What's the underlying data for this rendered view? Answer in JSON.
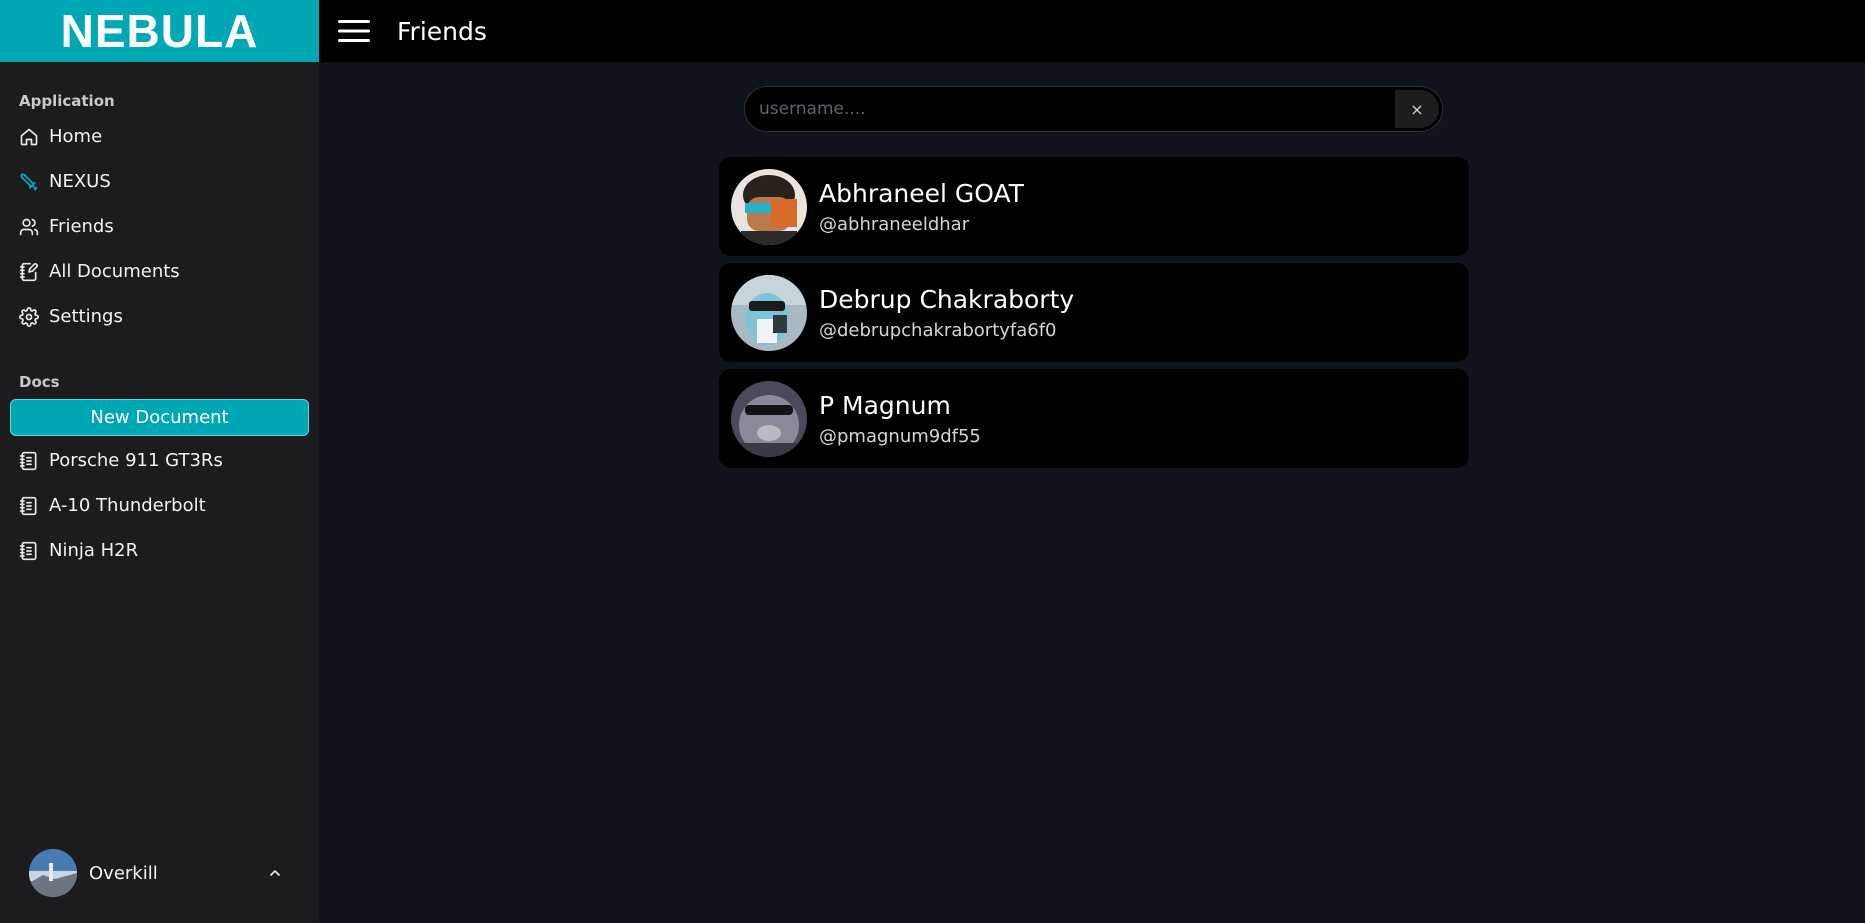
{
  "brand": {
    "title": "NEBULA"
  },
  "sidebar": {
    "application_label": "Application",
    "items": [
      {
        "label": "Home",
        "icon": "home-icon"
      },
      {
        "label": "NEXUS",
        "icon": "sword-icon"
      },
      {
        "label": "Friends",
        "icon": "users-icon"
      },
      {
        "label": "All Documents",
        "icon": "documents-icon"
      },
      {
        "label": "Settings",
        "icon": "gear-icon"
      }
    ],
    "docs_label": "Docs",
    "new_document_label": "New Document",
    "docs": [
      {
        "label": "Porsche 911 GT3Rs",
        "icon": "notebook-icon"
      },
      {
        "label": "A-10 Thunderbolt",
        "icon": "notebook-icon"
      },
      {
        "label": "Ninja H2R",
        "icon": "notebook-icon"
      }
    ],
    "user": {
      "name": "Overkill"
    }
  },
  "header": {
    "title": "Friends"
  },
  "search": {
    "placeholder": "username....",
    "value": "",
    "clear_label": "×"
  },
  "friends": [
    {
      "name": "Abhraneel GOAT",
      "handle": "@abhraneeldhar"
    },
    {
      "name": "Debrup Chakraborty",
      "handle": "@debrupchakrabortyfa6f0"
    },
    {
      "name": "P Magnum",
      "handle": "@pmagnum9df55"
    }
  ],
  "colors": {
    "accent": "#00a7b5",
    "sidebar_bg": "#1c1c1f",
    "main_bg": "#0f131c",
    "card_bg": "#000000"
  }
}
